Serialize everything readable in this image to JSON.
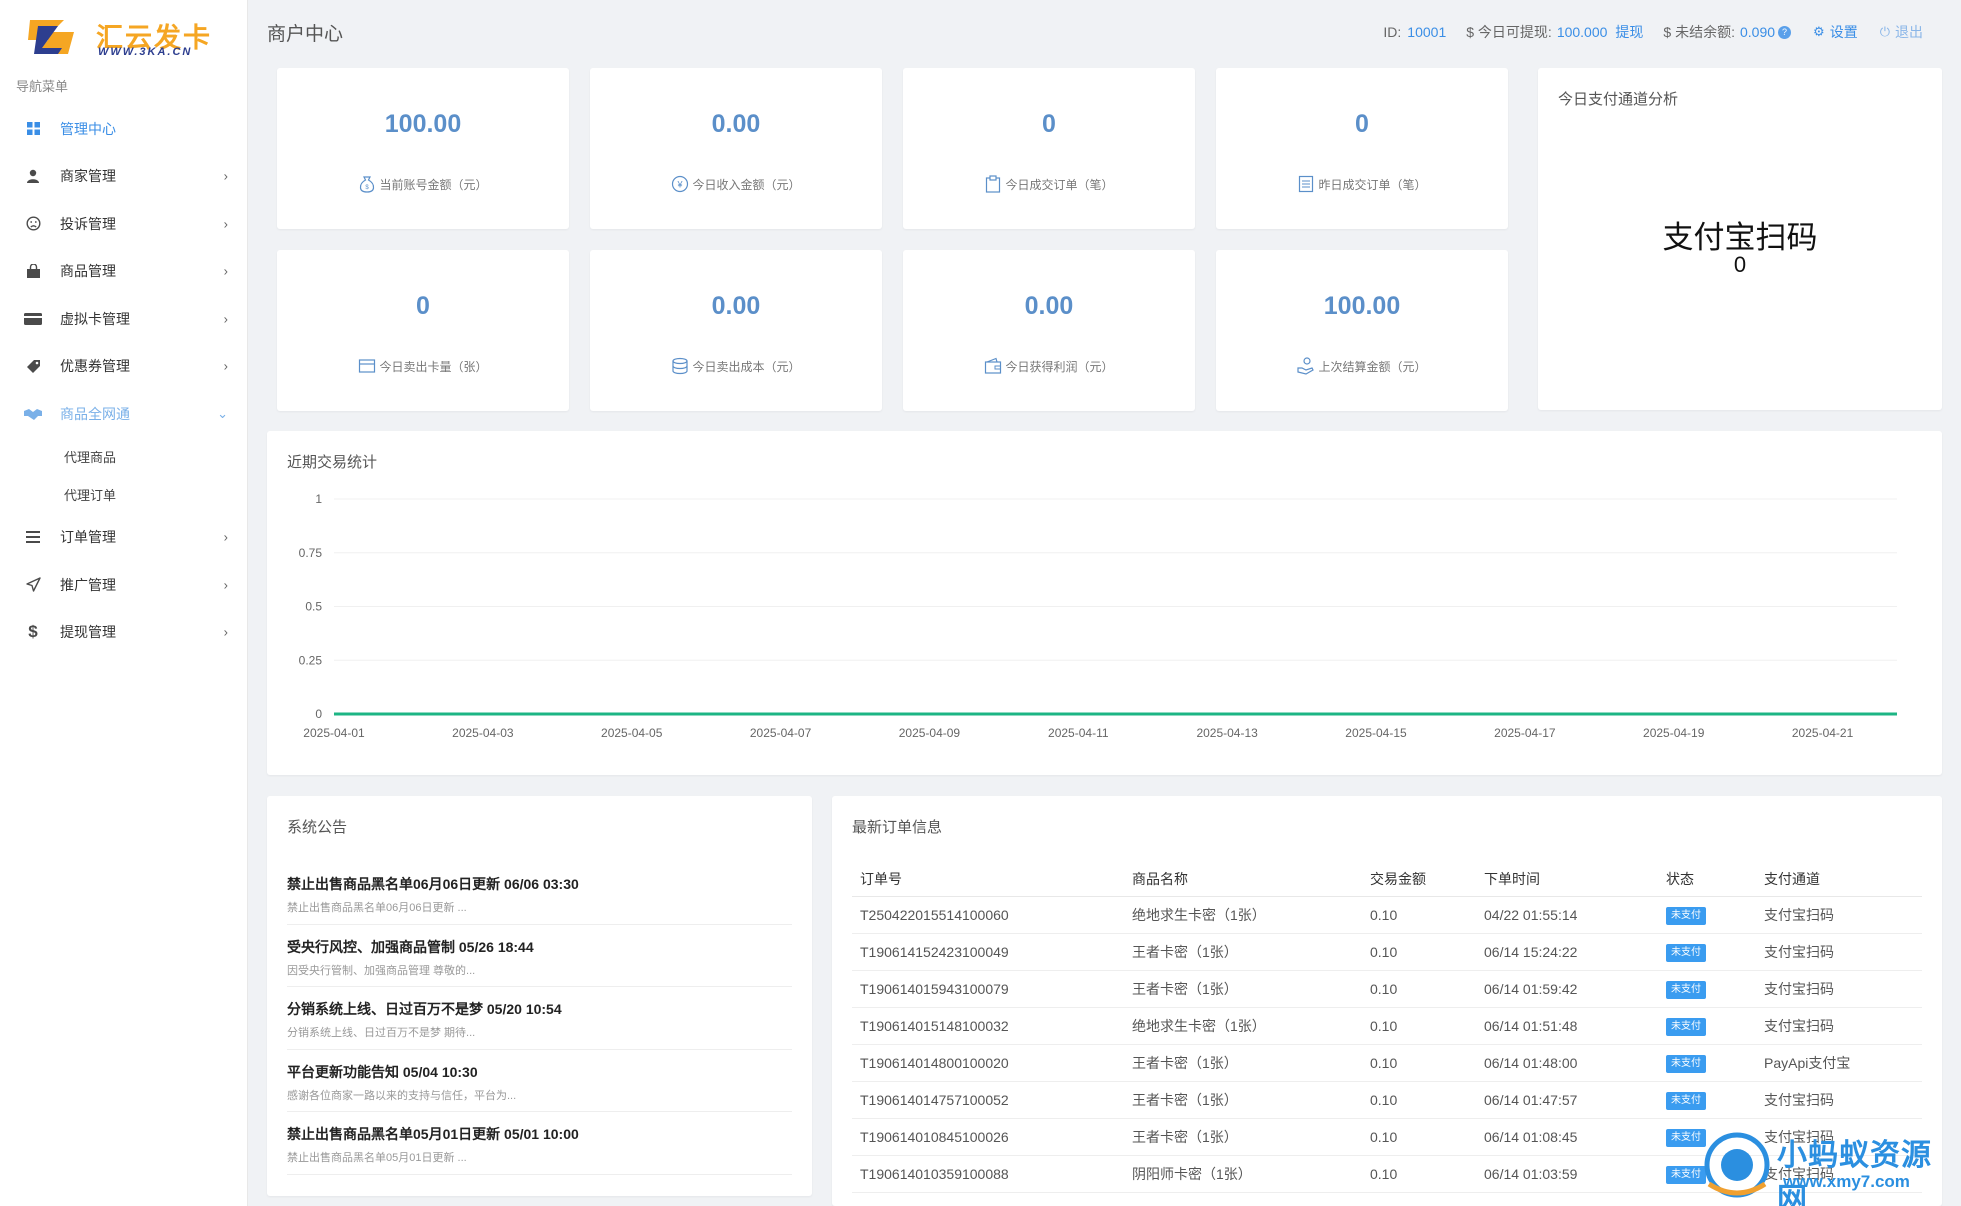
{
  "brand": {
    "name": "汇云发卡",
    "url": "WWW.3KA.CN"
  },
  "sidebar": {
    "caption": "导航菜单",
    "items": [
      {
        "label": "管理中心",
        "icon": "dashboard-icon"
      },
      {
        "label": "商家管理",
        "icon": "user-icon"
      },
      {
        "label": "投诉管理",
        "icon": "frown-icon"
      },
      {
        "label": "商品管理",
        "icon": "shopping-bag-icon"
      },
      {
        "label": "虚拟卡管理",
        "icon": "card-icon"
      },
      {
        "label": "优惠券管理",
        "icon": "tag-icon"
      },
      {
        "label": "商品全网通",
        "icon": "handshake-icon"
      },
      {
        "label": "订单管理",
        "icon": "list-icon"
      },
      {
        "label": "推广管理",
        "icon": "paper-plane-icon"
      },
      {
        "label": "提现管理",
        "icon": "dollar-icon"
      }
    ],
    "sub_items": [
      "代理商品",
      "代理订单"
    ]
  },
  "header": {
    "title": "商户中心",
    "id_label": "ID:",
    "id_value": "10001",
    "withdrawable_label": "$ 今日可提现:",
    "withdrawable_value": "100.000",
    "withdraw_link": "提现",
    "unsettled_label": "$ 未结余额:",
    "unsettled_value": "0.090",
    "help_mark": "?",
    "settings": "设置",
    "logout": "退出"
  },
  "stats": [
    {
      "value": "100.00",
      "label": "当前账号金额（元）",
      "icon": "money-bag-icon"
    },
    {
      "value": "0.00",
      "label": "今日收入金额（元）",
      "icon": "yen-coin-icon"
    },
    {
      "value": "0",
      "label": "今日成交订单（笔）",
      "icon": "clipboard-icon"
    },
    {
      "value": "0",
      "label": "昨日成交订单（笔）",
      "icon": "document-icon"
    },
    {
      "value": "0",
      "label": "今日卖出卡量（张）",
      "icon": "card-icon"
    },
    {
      "value": "0.00",
      "label": "今日卖出成本（元）",
      "icon": "coins-stack-icon"
    },
    {
      "value": "0.00",
      "label": "今日获得利润（元）",
      "icon": "wallet-icon"
    },
    {
      "value": "100.00",
      "label": "上次结算金额（元）",
      "icon": "hand-coins-icon"
    }
  ],
  "payment": {
    "title": "今日支付通道分析",
    "channel": "支付宝扫码",
    "value": "0"
  },
  "trend": {
    "title": "近期交易统计",
    "chart_data": {
      "type": "line",
      "x": [
        "2025-04-01",
        "2025-04-02",
        "2025-04-03",
        "2025-04-04",
        "2025-04-05",
        "2025-04-06",
        "2025-04-07",
        "2025-04-08",
        "2025-04-09",
        "2025-04-10",
        "2025-04-11",
        "2025-04-12",
        "2025-04-13",
        "2025-04-14",
        "2025-04-15",
        "2025-04-16",
        "2025-04-17",
        "2025-04-18",
        "2025-04-19",
        "2025-04-20",
        "2025-04-21",
        "2025-04-22"
      ],
      "x_tick_labels": [
        "2025-04-01",
        "2025-04-03",
        "2025-04-05",
        "2025-04-07",
        "2025-04-09",
        "2025-04-11",
        "2025-04-13",
        "2025-04-15",
        "2025-04-17",
        "2025-04-19",
        "2025-04-21"
      ],
      "series": [
        {
          "values": [
            0,
            0,
            0,
            0,
            0,
            0,
            0,
            0,
            0,
            0,
            0,
            0,
            0,
            0,
            0,
            0,
            0,
            0,
            0,
            0,
            0,
            0
          ],
          "color": "#1db584"
        }
      ],
      "ylim": [
        0,
        1
      ],
      "y_ticks": [
        "0",
        "0.25",
        "0.5",
        "0.75",
        "1"
      ],
      "grid": true
    }
  },
  "notices": {
    "title": "系统公告",
    "items": [
      {
        "title": "禁止出售商品黑名单06月06日更新 06/06 03:30",
        "desc": "禁止出售商品黑名单06月06日更新 ..."
      },
      {
        "title": "受央行风控、加强商品管制 05/26 18:44",
        "desc": "因受央行管制、加强商品管理 尊敬的..."
      },
      {
        "title": "分销系统上线、日过百万不是梦 05/20 10:54",
        "desc": "分销系统上线、日过百万不是梦 期待..."
      },
      {
        "title": "平台更新功能告知 05/04 10:30",
        "desc": "感谢各位商家一路以来的支持与信任，平台为..."
      },
      {
        "title": "禁止出售商品黑名单05月01日更新 05/01 10:00",
        "desc": "禁止出售商品黑名单05月01日更新 ..."
      }
    ]
  },
  "orders": {
    "title": "最新订单信息",
    "columns": [
      "订单号",
      "商品名称",
      "交易金额",
      "下单时间",
      "状态",
      "支付通道"
    ],
    "rows": [
      [
        "T250422015514100060",
        "绝地求生卡密（1张）",
        "0.10",
        "04/22 01:55:14",
        "未支付",
        "支付宝扫码"
      ],
      [
        "T190614152423100049",
        "王者卡密（1张）",
        "0.10",
        "06/14 15:24:22",
        "未支付",
        "支付宝扫码"
      ],
      [
        "T190614015943100079",
        "王者卡密（1张）",
        "0.10",
        "06/14 01:59:42",
        "未支付",
        "支付宝扫码"
      ],
      [
        "T190614015148100032",
        "绝地求生卡密（1张）",
        "0.10",
        "06/14 01:51:48",
        "未支付",
        "支付宝扫码"
      ],
      [
        "T190614014800100020",
        "王者卡密（1张）",
        "0.10",
        "06/14 01:48:00",
        "未支付",
        "PayApi支付宝"
      ],
      [
        "T190614014757100052",
        "王者卡密（1张）",
        "0.10",
        "06/14 01:47:57",
        "未支付",
        "支付宝扫码"
      ],
      [
        "T190614010845100026",
        "王者卡密（1张）",
        "0.10",
        "06/14 01:08:45",
        "未支付",
        "支付宝扫码"
      ],
      [
        "T190614010359100088",
        "阴阳师卡密（1张）",
        "0.10",
        "06/14 01:03:59",
        "未支付",
        "支付宝扫码"
      ]
    ]
  },
  "watermark": {
    "text": "小蚂蚁资源网",
    "url": "www.xmy7.com"
  },
  "colors": {
    "accent": "#3a8ee6",
    "stat_value": "#5b8fc9",
    "line": "#1db584",
    "badge": "#3a9cf0"
  }
}
